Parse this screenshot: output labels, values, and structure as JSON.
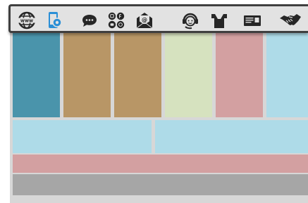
{
  "toolbar": {
    "icons": [
      {
        "name": "www-globe-icon"
      },
      {
        "name": "mobile-settings-icon"
      },
      {
        "name": "chat-bubble-icon"
      },
      {
        "name": "social-media-icon"
      },
      {
        "name": "email-icon"
      },
      {
        "name": "customer-support-icon"
      },
      {
        "name": "meeting-people-icon"
      },
      {
        "name": "contact-card-icon"
      },
      {
        "name": "handshake-icon"
      }
    ],
    "globe_label": "www",
    "email_label": "@"
  },
  "colors": {
    "toolbar_bg": "#e2e2e2",
    "toolbar_border": "#3f3f3f",
    "canvas_bg": "#d7d7d7",
    "icon_dark": "#262626",
    "icon_accent": "#2b8fd6",
    "teal": "#4a94ab",
    "tan": "#b89666",
    "pale_green": "#d6e2bf",
    "dusty_pink": "#d3a0a1",
    "light_blue": "#aedbe8",
    "gray": "#a6a6a6"
  }
}
